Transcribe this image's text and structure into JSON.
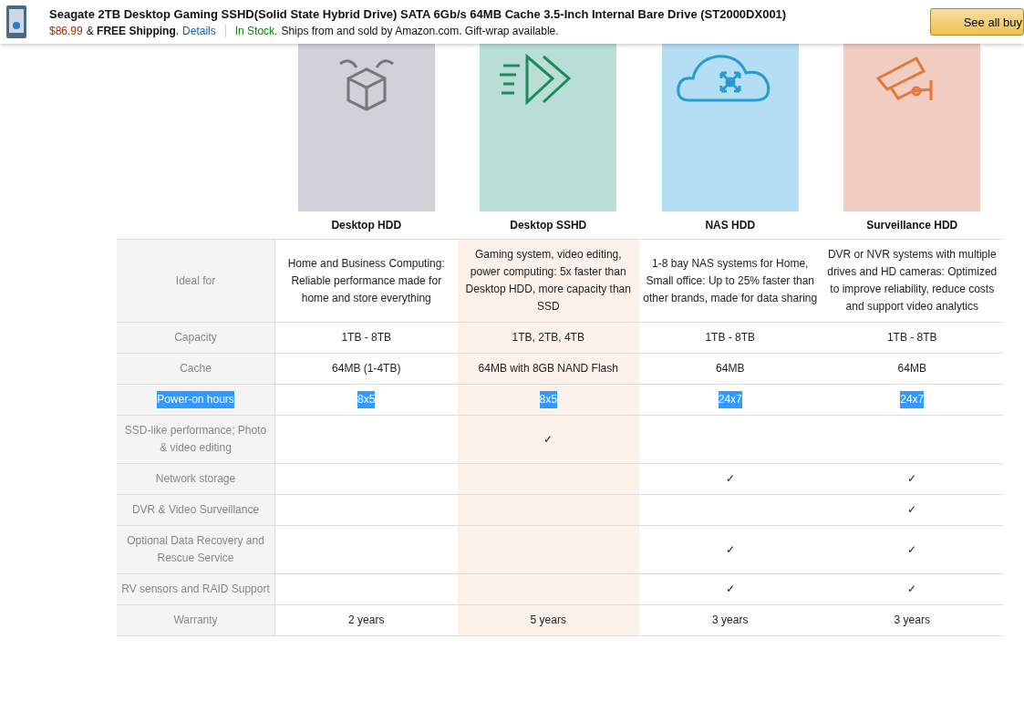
{
  "top_bar": {
    "title": "Seagate 2TB Desktop Gaming SSHD(Solid State Hybrid Drive) SATA 6Gb/s 64MB Cache 3.5-Inch Internal Bare Drive (ST2000DX001)",
    "price": "$86.99",
    "shipping": "& **FREE Shipping**.",
    "details_link": "Details",
    "stock": "In Stock.",
    "seller_note": "Ships from and sold by Amazon.com. Gift-wrap available.",
    "button": "See all buy"
  },
  "columns": [
    {
      "name": "Desktop HDD",
      "color": "#d0d1d9",
      "featured": false
    },
    {
      "name": "Desktop SSHD",
      "color": "#b8ded5",
      "featured": true
    },
    {
      "name": "NAS HDD",
      "color": "#b4def4",
      "featured": false
    },
    {
      "name": "Surveillance HDD",
      "color": "#f0cdc0",
      "featured": false
    }
  ],
  "rows": [
    {
      "label": "Ideal for",
      "selected": false,
      "cells": [
        "Home and Business Computing: Reliable performance made for home and store everything",
        "Gaming system, video editing, power computing: 5x faster than Desktop HDD, more capacity than SSD",
        "1-8 bay NAS systems for Home, Small office: Up to 25% faster than other brands, made for data sharing",
        "DVR or NVR systems with multiple drives and HD cameras: Optimized to improve reliability, reduce costs and support video analytics"
      ]
    },
    {
      "label": "Capacity",
      "selected": false,
      "cells": [
        "1TB - 8TB",
        "1TB, 2TB, 4TB",
        "1TB - 8TB",
        "1TB - 8TB"
      ]
    },
    {
      "label": "Cache",
      "selected": false,
      "cells": [
        "64MB (1-4TB)",
        "64MB with 8GB NAND Flash",
        "64MB",
        "64MB"
      ]
    },
    {
      "label": "Power-on hours",
      "selected": true,
      "cells": [
        "8x5",
        "8x5",
        "24x7",
        "24x7"
      ]
    },
    {
      "label": "SSD-like performance; Photo & video editing",
      "selected": false,
      "cells": [
        null,
        "✓",
        null,
        null
      ]
    },
    {
      "label": "Network storage",
      "selected": false,
      "cells": [
        null,
        null,
        "✓",
        "✓"
      ]
    },
    {
      "label": "DVR & Video Surveillance",
      "selected": false,
      "cells": [
        null,
        null,
        null,
        "✓"
      ]
    },
    {
      "label": "Optional Data Recovery and Rescue Service",
      "selected": false,
      "cells": [
        null,
        null,
        "✓",
        "✓"
      ]
    },
    {
      "label": "RV sensors and RAID Support",
      "selected": false,
      "cells": [
        null,
        null,
        "✓",
        "✓"
      ]
    },
    {
      "label": "Warranty",
      "selected": false,
      "cells": [
        "2 years",
        "5 years",
        "3 years",
        "3 years"
      ]
    }
  ]
}
